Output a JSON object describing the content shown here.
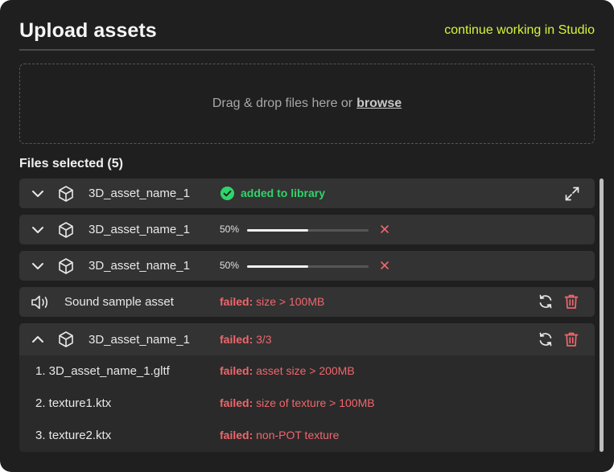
{
  "header": {
    "title": "Upload assets",
    "studio_link": "continue working in Studio"
  },
  "dropzone": {
    "text": "Drag & drop files here or",
    "browse_label": "browse"
  },
  "files": {
    "heading": "Files selected (5)",
    "items": [
      {
        "name": "3D_asset_name_1",
        "status": "added to library",
        "icon": "cube-icon"
      },
      {
        "name": "3D_asset_name_1",
        "progress_label": "50%",
        "progress": 0.5,
        "icon": "cube-icon"
      },
      {
        "name": "3D_asset_name_1",
        "progress_label": "50%",
        "progress": 0.5,
        "icon": "cube-icon"
      },
      {
        "name": "Sound sample asset",
        "failed_label": "failed:",
        "failed_detail": "size > 100MB",
        "icon": "speaker-icon"
      },
      {
        "name": "3D_asset_name_1",
        "failed_label": "failed:",
        "failed_detail": "3/3",
        "icon": "cube-icon",
        "subitems": [
          {
            "name": "1. 3D_asset_name_1.gltf",
            "failed_label": "failed:",
            "failed_detail": "asset size > 200MB"
          },
          {
            "name": "2. texture1.ktx",
            "failed_label": "failed:",
            "failed_detail": "size of texture > 100MB"
          },
          {
            "name": "3. texture2.ktx",
            "failed_label": "failed:",
            "failed_detail": "non-POT texture"
          }
        ]
      }
    ]
  },
  "colors": {
    "panel": "#1f1f1f",
    "row": "#333333",
    "accent": "#d7f53a",
    "success": "#2fd46a",
    "error": "#f0666c"
  }
}
